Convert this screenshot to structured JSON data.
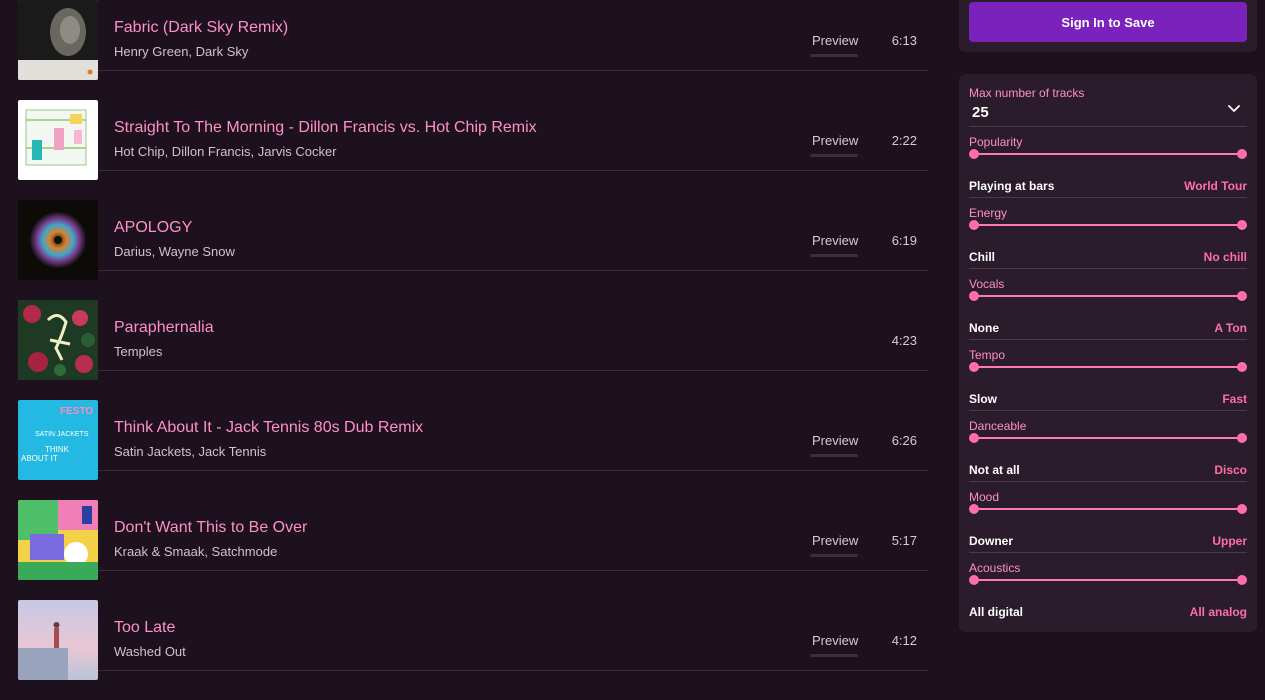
{
  "tracks": [
    {
      "title": "Fabric (Dark Sky Remix)",
      "artists": "Henry Green,  Dark Sky",
      "preview": "Preview",
      "duration": "6:13"
    },
    {
      "title": "Straight To The Morning - Dillon Francis vs. Hot Chip Remix",
      "artists": "Hot Chip,  Dillon Francis,  Jarvis Cocker",
      "preview": "Preview",
      "duration": "2:22"
    },
    {
      "title": "APOLOGY",
      "artists": "Darius,  Wayne Snow",
      "preview": "Preview",
      "duration": "6:19"
    },
    {
      "title": "Paraphernalia",
      "artists": "Temples",
      "preview": "",
      "duration": "4:23"
    },
    {
      "title": "Think About It - Jack Tennis 80s Dub Remix",
      "artists": "Satin Jackets,  Jack Tennis",
      "preview": "Preview",
      "duration": "6:26",
      "cover_text": [
        "FESTO",
        "SATIN JACKETS",
        "THINK",
        "ABOUT IT"
      ]
    },
    {
      "title": "Don't Want This to Be Over",
      "artists": "Kraak & Smaak,  Satchmode",
      "preview": "Preview",
      "duration": "5:17"
    },
    {
      "title": "Too Late",
      "artists": "Washed Out",
      "preview": "Preview",
      "duration": "4:12"
    }
  ],
  "sidebar": {
    "sign_in_label": "Sign In to Save",
    "max_tracks_label": "Max number of tracks",
    "max_tracks_value": "25",
    "sliders": [
      {
        "label": "Popularity",
        "min_label": "Playing at bars",
        "max_label": "World Tour",
        "range": [
          0,
          1
        ]
      },
      {
        "label": "Energy",
        "min_label": "Chill",
        "max_label": "No chill",
        "range": [
          0,
          1
        ]
      },
      {
        "label": "Vocals",
        "min_label": "None",
        "max_label": "A Ton",
        "range": [
          0,
          1
        ]
      },
      {
        "label": "Tempo",
        "min_label": "Slow",
        "max_label": "Fast",
        "range": [
          0,
          1
        ]
      },
      {
        "label": "Danceable",
        "min_label": "Not at all",
        "max_label": "Disco",
        "range": [
          0,
          1
        ]
      },
      {
        "label": "Mood",
        "min_label": "Downer",
        "max_label": "Upper",
        "range": [
          0,
          1
        ]
      },
      {
        "label": "Acoustics",
        "min_label": "All digital",
        "max_label": "All analog",
        "range": [
          0,
          1
        ]
      }
    ]
  },
  "colors": {
    "background": "#1c111d",
    "accent_pink": "#ff8fc8",
    "button_purple": "#7a22bb",
    "panel": "#2a1c2b"
  },
  "icons": {
    "dropdown": "chevron-down-icon"
  }
}
